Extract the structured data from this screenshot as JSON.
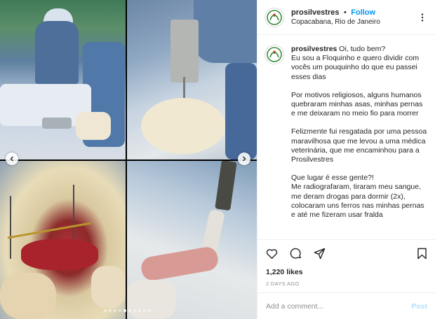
{
  "post": {
    "username": "prosilvestres",
    "follow_label": "Follow",
    "separator": "•",
    "location": "Copacabana, Rio de Janeiro",
    "caption_username": "prosilvestres",
    "caption_paragraphs": [
      "Oi, tudo bem?\nEu sou a Floquinho e quero dividir com vocês um pouquinho do que eu passei esses dias",
      "Por motivos religiosos, alguns humanos quebraram minhas asas, minhas pernas e me deixaram no meio fio para morrer",
      "Felizmente fui resgatada por uma pessoa maravilhosa que me levou a uma médica veterinária, que me encaminhou para a Prosilvestres",
      "Que lugar é esse gente?!\nMe radiografaram, tiraram meu sangue, me deram drogas para dormir (2x), colocaram uns ferros nas minhas pernas e até me fizeram usar fralda"
    ],
    "likes": "1,220 likes",
    "date": "2 DAYS AGO",
    "comment_placeholder": "Add a comment...",
    "post_label": "Post"
  },
  "media": {
    "dot_count": 10,
    "active_dot": 4
  },
  "colors": {
    "follow": "#0095f6",
    "post_disabled": "#b2dffc",
    "muted": "#8e8e8e",
    "logo_green": "#3a8a3a",
    "logo_red": "#c0392b"
  },
  "icons": {
    "avatar": "prosilvestres-logo",
    "more": "more-options-icon",
    "like": "heart-icon",
    "comment": "comment-icon",
    "share": "share-icon",
    "save": "bookmark-icon",
    "prev": "chevron-left-icon",
    "next": "chevron-right-icon"
  }
}
